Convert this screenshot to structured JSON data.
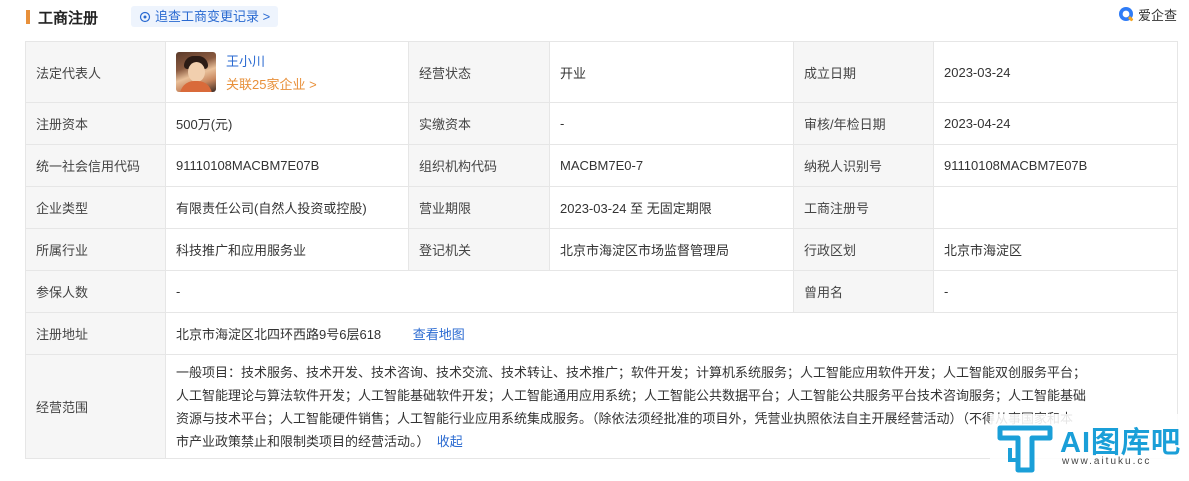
{
  "header": {
    "title": "工商注册",
    "track_link": "追查工商变更记录 >",
    "brand": "爱企查"
  },
  "legal_rep": {
    "label": "法定代表人",
    "name": "王小川",
    "related": "关联25家企业 >"
  },
  "rows": {
    "status": {
      "label": "经营状态",
      "value": "开业"
    },
    "founded": {
      "label": "成立日期",
      "value": "2023-03-24"
    },
    "reg_capital": {
      "label": "注册资本",
      "value": "500万(元)"
    },
    "paid_capital": {
      "label": "实缴资本",
      "value": "-"
    },
    "audit_date": {
      "label": "审核/年检日期",
      "value": "2023-04-24"
    },
    "credit_code": {
      "label": "统一社会信用代码",
      "value": "91110108MACBM7E07B"
    },
    "org_code": {
      "label": "组织机构代码",
      "value": "MACBM7E0-7"
    },
    "tax_id": {
      "label": "纳税人识别号",
      "value": "91110108MACBM7E07B"
    },
    "company_type": {
      "label": "企业类型",
      "value": "有限责任公司(自然人投资或控股)"
    },
    "business_term": {
      "label": "营业期限",
      "value": "2023-03-24 至 无固定期限"
    },
    "reg_number": {
      "label": "工商注册号",
      "value": ""
    },
    "industry": {
      "label": "所属行业",
      "value": "科技推广和应用服务业"
    },
    "authority": {
      "label": "登记机关",
      "value": "北京市海淀区市场监督管理局"
    },
    "district": {
      "label": "行政区划",
      "value": "北京市海淀区"
    },
    "insured": {
      "label": "参保人数",
      "value": "-"
    },
    "former_name": {
      "label": "曾用名",
      "value": "-"
    },
    "address": {
      "label": "注册地址",
      "value": "北京市海淀区北四环西路9号6层618",
      "map_link": "查看地图"
    },
    "scope": {
      "label": "经营范围",
      "lines": [
        "一般项目：技术服务、技术开发、技术咨询、技术交流、技术转让、技术推广；软件开发；计算机系统服务；人工智能应用软件开发；人工智能双创服务平台；",
        "人工智能理论与算法软件开发；人工智能基础软件开发；人工智能通用应用系统；人工智能公共数据平台；人工智能公共服务平台技术咨询服务；人工智能基础",
        "资源与技术平台；人工智能硬件销售；人工智能行业应用系统集成服务。（除依法须经批准的项目外，凭营业执照依法自主开展经营活动）（不得从事国家和本",
        "市产业政策禁止和限制类项目的经营活动。）"
      ],
      "fold": "收起"
    }
  },
  "watermark": {
    "text": "AI图库吧",
    "url": "www.aituku.cc"
  },
  "colors": {
    "accent": "#e8903a",
    "link": "#2a6ad1",
    "label_bg": "#f6f6f6",
    "border": "#e6e6e6",
    "watermark": "#1a9fd8"
  }
}
